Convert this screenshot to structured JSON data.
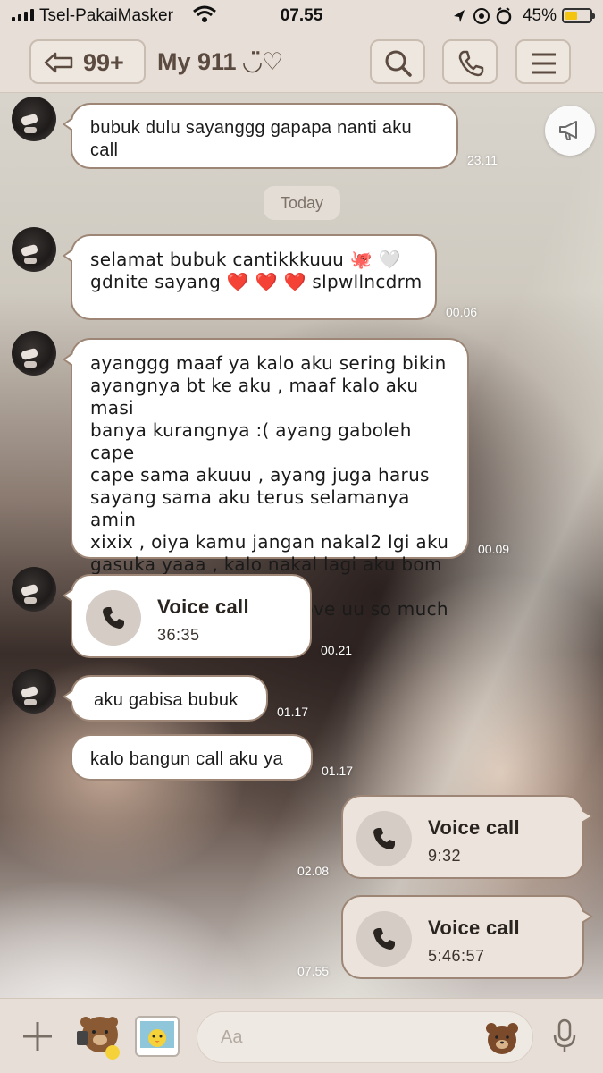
{
  "status_bar": {
    "carrier": "Tsel-PakaiMasker",
    "time": "07.55",
    "battery": "45%"
  },
  "header": {
    "unread_count": "99+",
    "chat_name": "My 911 ◡̈♡"
  },
  "date_separator": "Today",
  "messages": [
    {
      "type": "text",
      "direction": "in",
      "text": "bubuk dulu sayanggg gapapa nanti aku\ncall",
      "time": "23.11"
    },
    {
      "type": "text",
      "direction": "in",
      "text": "selamat bubuk cantikkkuuu 🐙 🤍\ngdnite sayang ❤️ ❤️ ❤️ slpwllncdrm",
      "time": "00.06"
    },
    {
      "type": "text",
      "direction": "in",
      "text": "ayanggg maaf ya kalo aku sering bikin\nayangnya bt ke aku , maaf kalo aku masi\nbanya kurangnya :(  ayang gaboleh cape\ncape sama akuuu , ayang juga harus\nsayang sama aku terus selamanya amin\nxixix , oiya kamu jangan nakal2 lgi aku\ngasuka yaaa , kalo nakal lagi aku bom itu\nrumah pinat wleee 🤪 love uu so much\n❤️‍🔥 ❤️‍🔥 miss u 🥺 🥺 🥺",
      "time": "00.09"
    },
    {
      "type": "call",
      "direction": "in",
      "label": "Voice call",
      "duration": "36:35",
      "time": "00.21"
    },
    {
      "type": "text",
      "direction": "in",
      "text": "aku gabisa bubuk",
      "time": "01.17"
    },
    {
      "type": "text",
      "direction": "in",
      "text": "kalo bangun call aku ya",
      "time": "01.17"
    },
    {
      "type": "call",
      "direction": "out",
      "label": "Voice call",
      "duration": "9:32",
      "time": "02.08"
    },
    {
      "type": "call",
      "direction": "out",
      "label": "Voice call",
      "duration": "5:46:57",
      "time": "07.55"
    }
  ],
  "composer": {
    "placeholder": "Aa"
  },
  "icons": {
    "back": "back-arrow-icon",
    "search": "search-icon",
    "call": "phone-icon",
    "menu": "menu-icon",
    "announce": "megaphone-icon",
    "plus": "plus-icon",
    "mic": "microphone-icon"
  },
  "colors": {
    "header_bg": "#e7dfd7",
    "bubble_border": "#9d8675",
    "title_text": "#5b4a3f",
    "battery_fill": "#f3c510"
  }
}
